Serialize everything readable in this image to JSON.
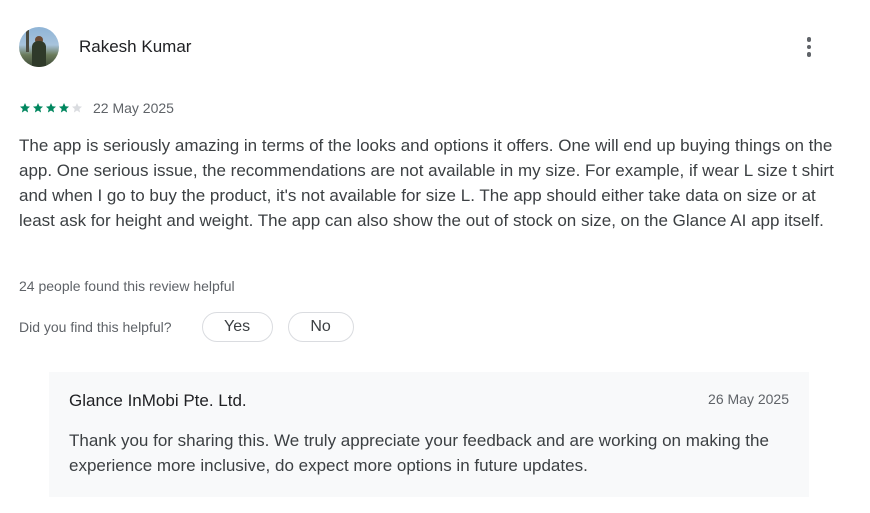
{
  "review": {
    "author": "Rakesh Kumar",
    "rating": 4,
    "max_rating": 5,
    "date": "22 May 2025",
    "text": "The app is seriously amazing in terms of the looks and options it offers. One will end up buying things on the app. One serious issue, the recommendations are not available in my size. For example, if wear L size t shirt and when I go to buy the product, it's not available for size L. The app should either take data on size or at least ask for height and weight. The app can also show the out of stock on size, on the Glance AI app itself.",
    "helpful_count_text": "24 people found this review helpful"
  },
  "helpful": {
    "question": "Did you find this helpful?",
    "yes_label": "Yes",
    "no_label": "No"
  },
  "reply": {
    "developer": "Glance InMobi Pte. Ltd.",
    "date": "26 May 2025",
    "text": "Thank you for sharing this. We truly appreciate your feedback and are working on making the experience more inclusive, do expect more options in future updates."
  },
  "colors": {
    "star_filled": "#01875f",
    "star_empty": "#dadce0"
  },
  "icons": {
    "more": "more-vert-icon",
    "star": "star-icon"
  }
}
